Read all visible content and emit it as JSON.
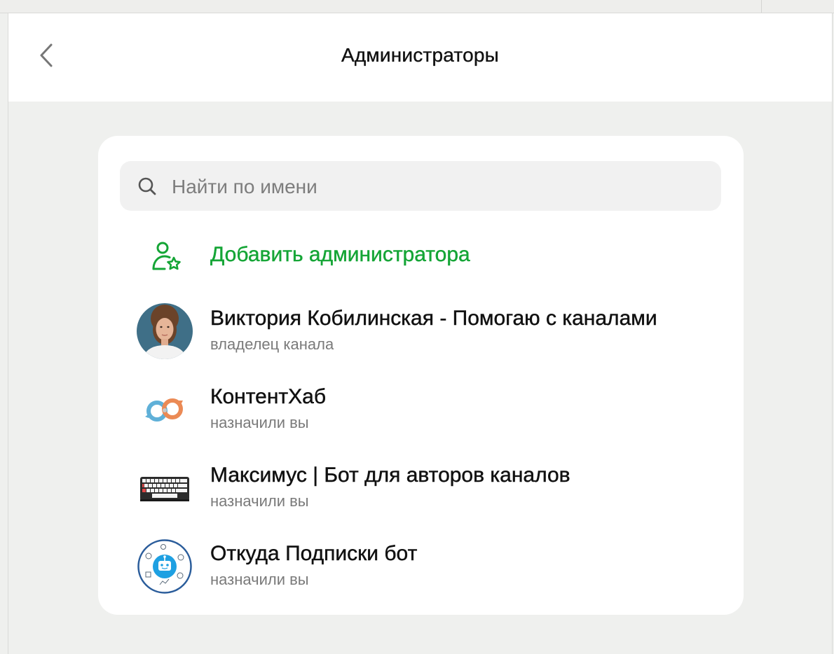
{
  "header": {
    "title": "Администраторы",
    "back_icon": "chevron-left-icon"
  },
  "search": {
    "placeholder": "Найти по имени",
    "value": "",
    "icon": "search-icon"
  },
  "add_admin": {
    "label": "Добавить администратора",
    "icon": "user-star-icon",
    "color": "#15a536"
  },
  "admins": [
    {
      "name": "Виктория Кобилинская - Помогаю с каналами",
      "role": "владелец канала",
      "avatar": "photo-avatar"
    },
    {
      "name": "КонтентХаб",
      "role": "назначили вы",
      "avatar": "infinity-arrows-logo"
    },
    {
      "name": "Максимус | Бот для авторов каналов",
      "role": "назначили вы",
      "avatar": "keyboard-logo"
    },
    {
      "name": "Откуда Подписки бот",
      "role": "назначили вы",
      "avatar": "robot-circle-logo"
    }
  ]
}
